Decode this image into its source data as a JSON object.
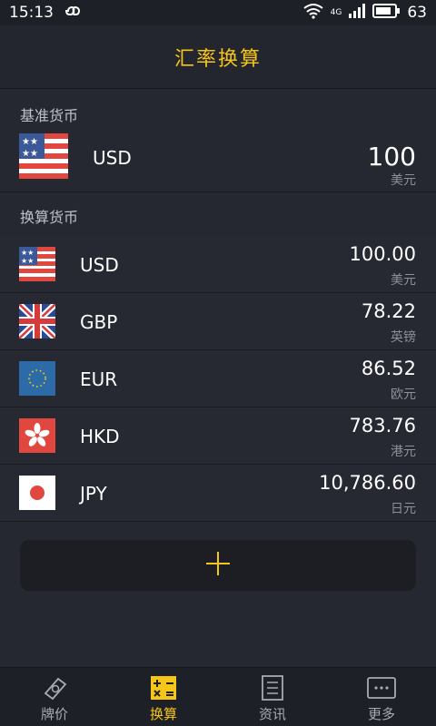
{
  "status_bar": {
    "time": "15:13",
    "network": "4G",
    "battery": "63"
  },
  "header": {
    "title": "汇率换算"
  },
  "base": {
    "label": "基准货币",
    "code": "USD",
    "amount": "100",
    "unit": "美元"
  },
  "convert": {
    "label": "换算货币",
    "items": [
      {
        "code": "USD",
        "amount": "100.00",
        "unit": "美元"
      },
      {
        "code": "GBP",
        "amount": "78.22",
        "unit": "英镑"
      },
      {
        "code": "EUR",
        "amount": "86.52",
        "unit": "欧元"
      },
      {
        "code": "HKD",
        "amount": "783.76",
        "unit": "港元"
      },
      {
        "code": "JPY",
        "amount": "10,786.60",
        "unit": "日元"
      }
    ]
  },
  "add_button": {
    "icon": "plus-icon"
  },
  "tabs": [
    {
      "label": "牌价",
      "icon": "price-tag-icon",
      "active": false
    },
    {
      "label": "换算",
      "icon": "calculator-icon",
      "active": true
    },
    {
      "label": "资讯",
      "icon": "news-icon",
      "active": false
    },
    {
      "label": "更多",
      "icon": "more-icon",
      "active": false
    }
  ],
  "colors": {
    "accent": "#f5c518",
    "background": "#252831"
  }
}
